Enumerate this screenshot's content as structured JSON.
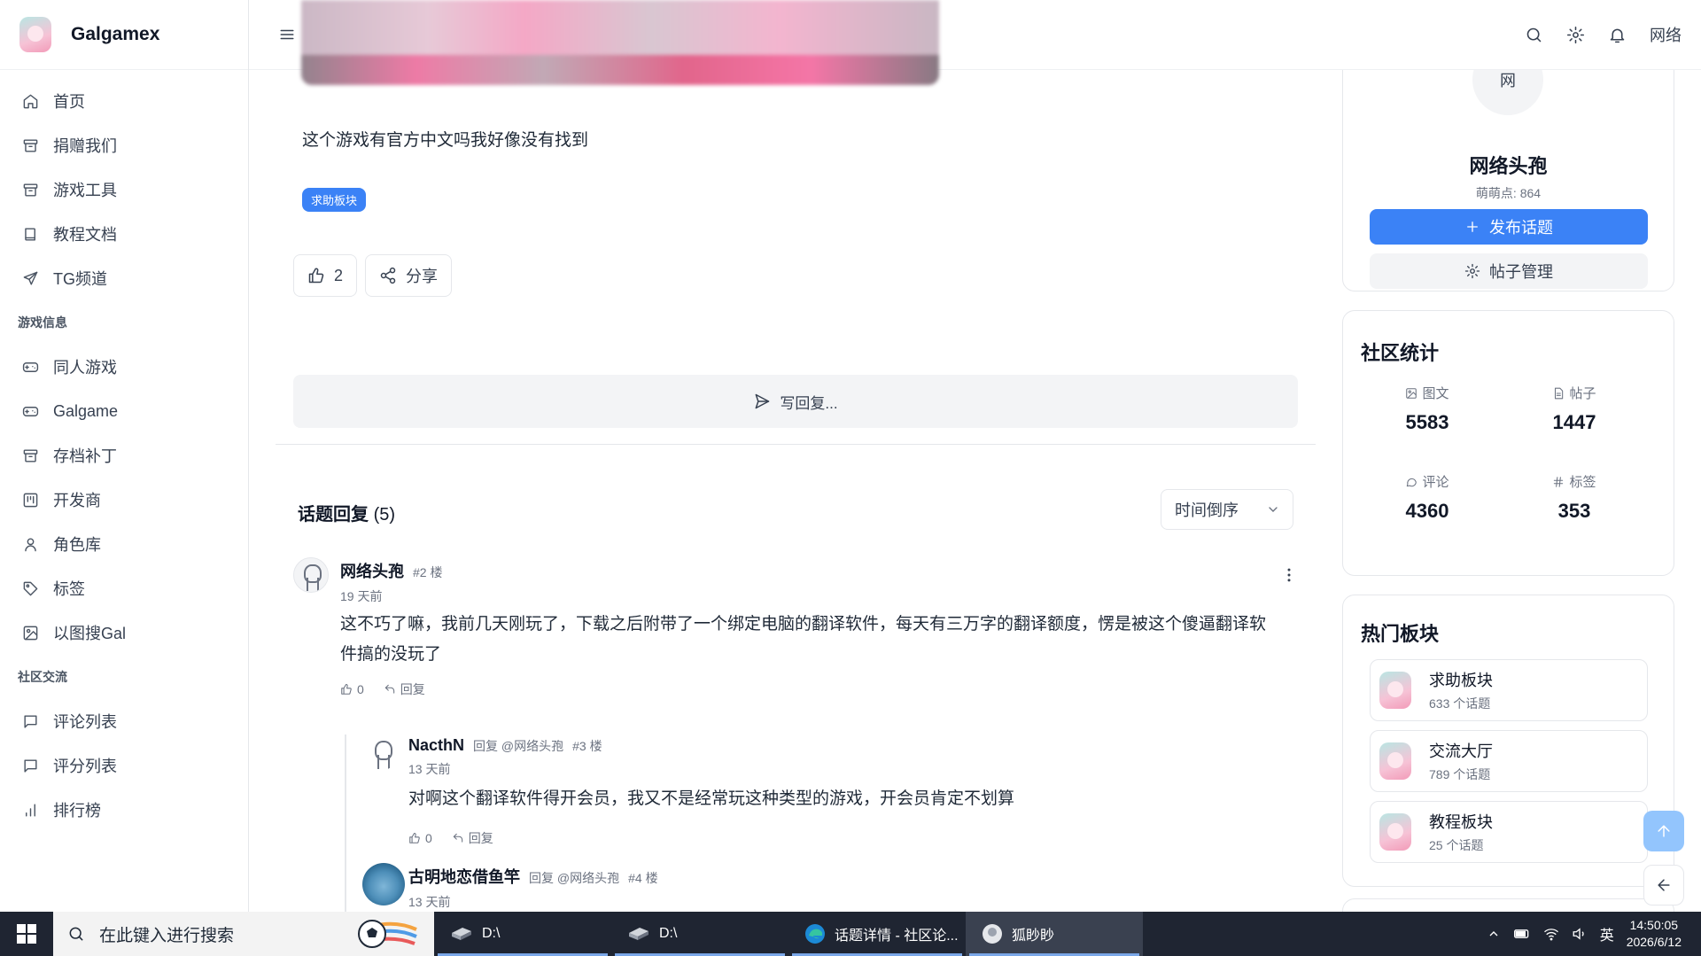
{
  "brand": {
    "name": "Galgamex"
  },
  "sidebar": {
    "items": [
      {
        "label": "首页",
        "icon": "home-icon"
      },
      {
        "label": "捐赠我们",
        "icon": "archive-icon"
      },
      {
        "label": "游戏工具",
        "icon": "archive-icon"
      },
      {
        "label": "教程文档",
        "icon": "book-icon"
      },
      {
        "label": "TG频道",
        "icon": "send-icon"
      }
    ],
    "section_game": "游戏信息",
    "game_items": [
      {
        "label": "同人游戏",
        "icon": "gamepad-icon"
      },
      {
        "label": "Galgame",
        "icon": "gamepad-icon"
      },
      {
        "label": "存档补丁",
        "icon": "archive-icon"
      },
      {
        "label": "开发商",
        "icon": "kanban-icon"
      },
      {
        "label": "角色库",
        "icon": "user-icon"
      },
      {
        "label": "标签",
        "icon": "tag-icon"
      },
      {
        "label": "以图搜Gal",
        "icon": "image-icon"
      }
    ],
    "section_community": "社区交流",
    "community_items": [
      {
        "label": "评论列表",
        "icon": "message-icon"
      },
      {
        "label": "评分列表",
        "icon": "message-icon"
      },
      {
        "label": "排行榜",
        "icon": "bar-chart-icon"
      }
    ]
  },
  "header": {
    "user_label": "网络"
  },
  "post": {
    "text": "这个游戏有官方中文吗我好像没有找到",
    "tag": "求助板块",
    "likes": "2",
    "share_label": "分享",
    "reply_placeholder": "写回复..."
  },
  "replies": {
    "title": "话题回复",
    "count": "(5)",
    "sort_label": "时间倒序",
    "items": [
      {
        "name": "网络头孢",
        "floor": "#2 楼",
        "time": "19 天前",
        "body": "这不巧了嘛，我前几天刚玩了，下载之后附带了一个绑定电脑的翻译软件，每天有三万字的翻译额度，愣是被这个傻逼翻译软件搞的没玩了",
        "likes": "0",
        "reply_label": "回复"
      },
      {
        "name": "NacthN",
        "reply_to": "回复 @网络头孢",
        "floor": "#3 楼",
        "time": "13 天前",
        "body": "对啊这个翻译软件得开会员，我又不是经常玩这种类型的游戏，开会员肯定不划算",
        "likes": "0",
        "reply_label": "回复"
      },
      {
        "name": "古明地恋借鱼竿",
        "reply_to": "回复 @网络头孢",
        "floor": "#4 楼",
        "time": "13 天前"
      }
    ]
  },
  "profile": {
    "avatar_text": "网",
    "name": "网络头孢",
    "points": "萌萌点: 864",
    "publish_label": "发布话题",
    "manage_label": "帖子管理"
  },
  "stats": {
    "title": "社区统计",
    "items": [
      {
        "label": "图文",
        "value": "5583",
        "icon": "image-icon"
      },
      {
        "label": "帖子",
        "value": "1447",
        "icon": "file-icon"
      },
      {
        "label": "评论",
        "value": "4360",
        "icon": "comment-icon"
      },
      {
        "label": "标签",
        "value": "353",
        "icon": "hash-icon"
      }
    ]
  },
  "hot": {
    "title": "热门板块",
    "boards": [
      {
        "name": "求助板块",
        "count": "633 个话题"
      },
      {
        "name": "交流大厅",
        "count": "789 个话题"
      },
      {
        "name": "教程板块",
        "count": "25 个话题"
      }
    ]
  },
  "taskbar": {
    "search_placeholder": "在此键入进行搜索",
    "apps": [
      {
        "label": "D:\\"
      },
      {
        "label": "D:\\"
      },
      {
        "label": "话题详情 - 社区论..."
      },
      {
        "label": "狐眇眇"
      }
    ],
    "ime": "英",
    "time": "14:50:05",
    "date": "2026/6/12"
  },
  "colors": {
    "accent": "#3b82f6",
    "taskbar": "#1f2532"
  }
}
